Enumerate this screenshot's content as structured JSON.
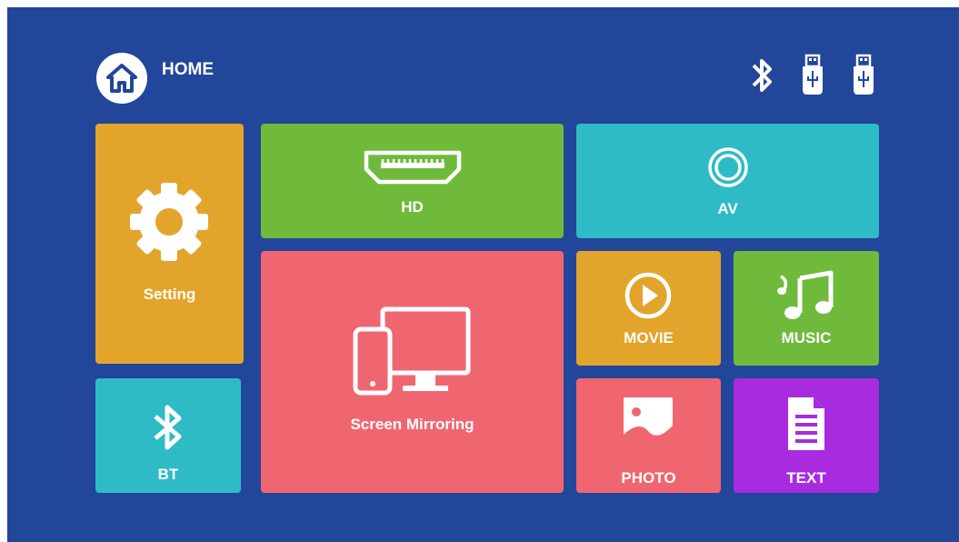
{
  "header": {
    "home_label": "HOME",
    "home_icon": "home-icon",
    "status_icons": [
      "bluetooth-icon",
      "usb-drive-icon",
      "usb-drive-icon"
    ]
  },
  "tiles": {
    "setting": {
      "label": "Setting",
      "color": "#e2a42b",
      "icon": "gear-icon"
    },
    "hd": {
      "label": "HD",
      "color": "#6fba3b",
      "icon": "hdmi-port-icon"
    },
    "av": {
      "label": "AV",
      "color": "#2ebbc6",
      "icon": "av-ring-icon"
    },
    "screen_mirroring": {
      "label": "Screen Mirroring",
      "color": "#f06670",
      "icon": "phone-monitor-icon"
    },
    "movie": {
      "label": "MOVIE",
      "color": "#e2a42b",
      "icon": "play-icon"
    },
    "music": {
      "label": "MUSIC",
      "color": "#6fba3b",
      "icon": "music-note-icon"
    },
    "bt": {
      "label": "BT",
      "color": "#2ebbc6",
      "icon": "bluetooth-icon"
    },
    "photo": {
      "label": "PHOTO",
      "color": "#f06670",
      "icon": "photo-icon"
    },
    "text": {
      "label": "TEXT",
      "color": "#a92be0",
      "icon": "document-icon"
    }
  }
}
